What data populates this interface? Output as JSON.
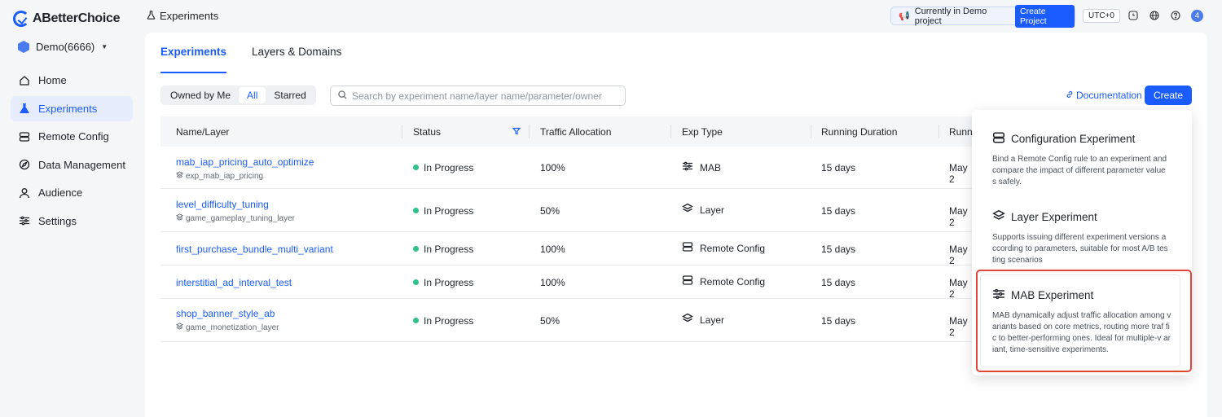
{
  "brand": {
    "name": "ABetterChoice"
  },
  "project": {
    "name": "Demo(6666)"
  },
  "sidebar": {
    "items": [
      {
        "label": "Home",
        "icon": "home-icon"
      },
      {
        "label": "Experiments",
        "icon": "flask-icon",
        "active": true
      },
      {
        "label": "Remote Config",
        "icon": "server-icon"
      },
      {
        "label": "Data Management",
        "icon": "compass-icon"
      },
      {
        "label": "Audience",
        "icon": "user-icon"
      },
      {
        "label": "Settings",
        "icon": "sliders-icon"
      }
    ]
  },
  "header": {
    "breadcrumb": "Experiments",
    "demo_notice": "Currently in Demo project",
    "create_project": "Create Project",
    "timezone": "UTC+0",
    "notification_count": "4"
  },
  "tabs": [
    {
      "label": "Experiments",
      "active": true
    },
    {
      "label": "Layers & Domains",
      "active": false
    }
  ],
  "filter": {
    "segments": [
      {
        "label": "Owned by Me",
        "active": false
      },
      {
        "label": "All",
        "active": true
      },
      {
        "label": "Starred",
        "active": false
      }
    ],
    "search_placeholder": "Search by experiment name/layer name/parameter/owner"
  },
  "actions": {
    "documentation": "Documentation",
    "create": "Create"
  },
  "table": {
    "columns": [
      "Name/Layer",
      "Status",
      "Traffic Allocation",
      "Exp Type",
      "Running Duration",
      "Runni"
    ],
    "rows": [
      {
        "name": "mab_iap_pricing_auto_optimize",
        "layer": "exp_mab_iap_pricing",
        "status": "In Progress",
        "traffic": "100%",
        "type": "MAB",
        "type_icon": "sliders-icon",
        "duration": "15 days",
        "date": "May 2"
      },
      {
        "name": "level_difficulty_tuning",
        "layer": "game_gameplay_tuning_layer",
        "status": "In Progress",
        "traffic": "50%",
        "type": "Layer",
        "type_icon": "layers-icon",
        "duration": "15 days",
        "date": "May 2"
      },
      {
        "name": "first_purchase_bundle_multi_variant",
        "layer": "",
        "status": "In Progress",
        "traffic": "100%",
        "type": "Remote Config",
        "type_icon": "server-icon",
        "duration": "15 days",
        "date": "May 2"
      },
      {
        "name": "interstitial_ad_interval_test",
        "layer": "",
        "status": "In Progress",
        "traffic": "100%",
        "type": "Remote Config",
        "type_icon": "server-icon",
        "duration": "15 days",
        "date": "May 2"
      },
      {
        "name": "shop_banner_style_ab",
        "layer": "game_monetization_layer",
        "status": "In Progress",
        "traffic": "50%",
        "type": "Layer",
        "type_icon": "layers-icon",
        "duration": "15 days",
        "date": "May 2"
      }
    ]
  },
  "create_menu": {
    "items": [
      {
        "title": "Configuration Experiment",
        "icon": "server-icon",
        "description": "Bind a Remote Config rule to an experiment and compare the impact of different parameter value s safely."
      },
      {
        "title": "Layer Experiment",
        "icon": "layers-icon",
        "description": "Supports issuing different experiment versions a ccording to parameters, suitable for most A/B tes ting scenarios"
      },
      {
        "title": "MAB Experiment",
        "icon": "sliders-icon",
        "description": "MAB dynamically adjust traffic allocation among variants based on core metrics, routing more traf fic to better-performing ones. Ideal for multiple-v ariant, time-sensitive experiments.",
        "highlighted": true
      }
    ]
  },
  "colors": {
    "accent": "#1a5cff",
    "status_green": "#2ec28a",
    "highlight_red": "#e0453a"
  }
}
